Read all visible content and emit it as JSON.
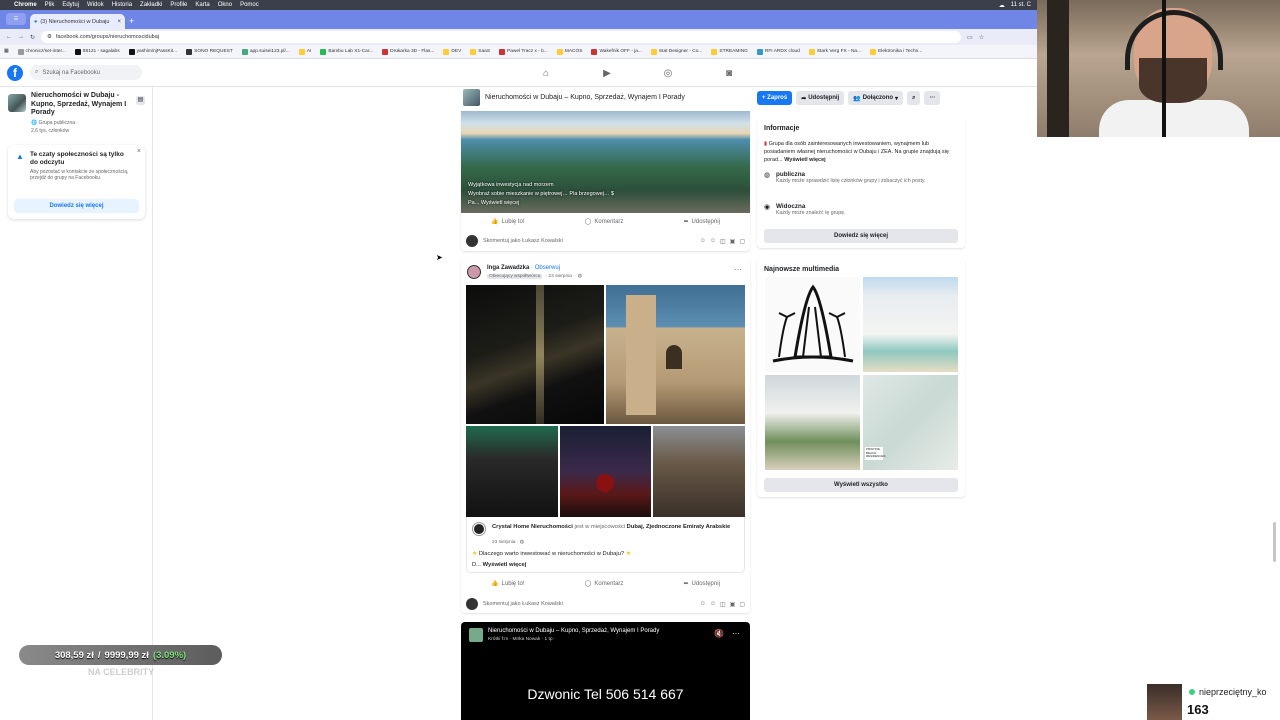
{
  "mac_menu": {
    "app": "Chrome",
    "items": [
      "Plik",
      "Edytuj",
      "Widok",
      "Historia",
      "Zakładki",
      "Profile",
      "Karta",
      "Okno",
      "Pomoc"
    ],
    "clock": "11 st. C"
  },
  "browser": {
    "tab_title": "(3) Nieruchomości w Dubaju",
    "url": "facebook.com/groups/nieruchomoscidubaj",
    "bookmarks": [
      "chronicz/set-inter...",
      "tt8121 - sagalabs",
      "yashim/njPassKit...",
      "SONO REQUEST",
      "app.suisei123.pl/...",
      "AI",
      "Bambu Lab X1-Car...",
      "Drukarka 3D - Flas...",
      "DEV",
      "SaaS",
      "Pawel Tracz x - b...",
      "MACOS",
      "Wakefnik OFF - ja...",
      "Stat Designer - Co...",
      "STREAMING",
      "RFI ARDX cloud",
      "Stark Verg FX - Na...",
      "Elektronika i Techn..."
    ]
  },
  "fb": {
    "search_placeholder": "Szukaj na Facebooku",
    "nav_icons": [
      "home-icon",
      "video-icon",
      "marketplace-icon",
      "gaming-icon"
    ]
  },
  "left": {
    "group_name": "Nieruchomości w Dubaju - Kupno, Sprzedaż, Wynajem I Porady",
    "privacy": "Grupa publiczna ·",
    "members": "2,6 tys. członków",
    "notice_title": "Te czaty społeczności są tylko do odczytu",
    "notice_body": "Aby pozostać w kontakcie ze społecznością, przejdź do grupy na Facebooku.",
    "notice_button": "Dowiedz się więcej"
  },
  "group_header": {
    "title": "Nieruchomości w Dubaju – Kupno, Sprzedaż, Wynajem I Porady",
    "invite": "+ Zaproś",
    "share": "Udostępnij",
    "joined": "Dołączono"
  },
  "post1": {
    "overlay_line1": "Wyjątkowa inwestycja nad morzem",
    "overlay_line2": "Wyobraź sobie mieszkanie w piętrowej… Pla brzegowej… $",
    "overlay_line3": "Pa... Wyświetl więcej",
    "like": "Lubię to!",
    "comment": "Komentarz",
    "share": "Udostępnij",
    "comment_placeholder": "Skomentuj jako Łukasz Kowalski"
  },
  "post2": {
    "author": "Inga Zawadzka",
    "follow": "· Obserwuj",
    "badge": "Obiecujący współtwórca",
    "date": "· 23 sierpnia ·",
    "shared_page": "Crystal Home Nieruchomości",
    "shared_mid": " jest w miejscowości ",
    "shared_place": "Dubaj, Zjednoczone Emiraty Arabskie",
    "shared_date": "23 sierpnia · ",
    "shared_text1": "Dlaczego warto inwestować w nieruchomości w Dubaju?",
    "shared_text2_prefix": "D... ",
    "shared_more": "Wyświetl więcej",
    "like": "Lubię to!",
    "comment": "Komentarz",
    "share": "Udostępnij",
    "comment_placeholder": "Skomentuj jako Łukasz Kowalski"
  },
  "video": {
    "title": "Nieruchomości w Dubaju – Kupno, Sprzedaż, Wynajem I Porady",
    "sub": "Krótki f:m · Mirka Nowak · 1 tp ·",
    "big_text": "Dzwonic Tel 506 514 667"
  },
  "info": {
    "title": "Informacje",
    "desc": "Grupa dla osób zainteresowanych inwestowaniem, wynajmem lub posiadaniem własnej nieruchomości w Dubaju i ZEA. Na grupie znajdują się porad...",
    "desc_more": "Wyświetl więcej",
    "public_title": "publiczna",
    "public_desc": "Każdy może sprawdzić listę członków grupy i zobaczyć ich posty.",
    "visible_title": "Widoczna",
    "visible_desc": "Każdy może znaleźć tę grupę.",
    "button": "Dowiedz się więcej"
  },
  "media": {
    "title": "Najnowsze multimedia",
    "button": "Wyświetl wszystko",
    "map_label": "PRISTINE · BEACH · RESIDENCES"
  },
  "overlay": {
    "widget_a": "308,59 zł",
    "widget_b": "9999,99 zł",
    "widget_c": "(3.09%)",
    "widget_label": "NA CELEBRITY",
    "viewer_name": "nieprzeciętny_ko",
    "viewer_count": "163"
  },
  "colors": {
    "fb_blue": "#1877f2",
    "tab_bar": "#6f86e6"
  }
}
